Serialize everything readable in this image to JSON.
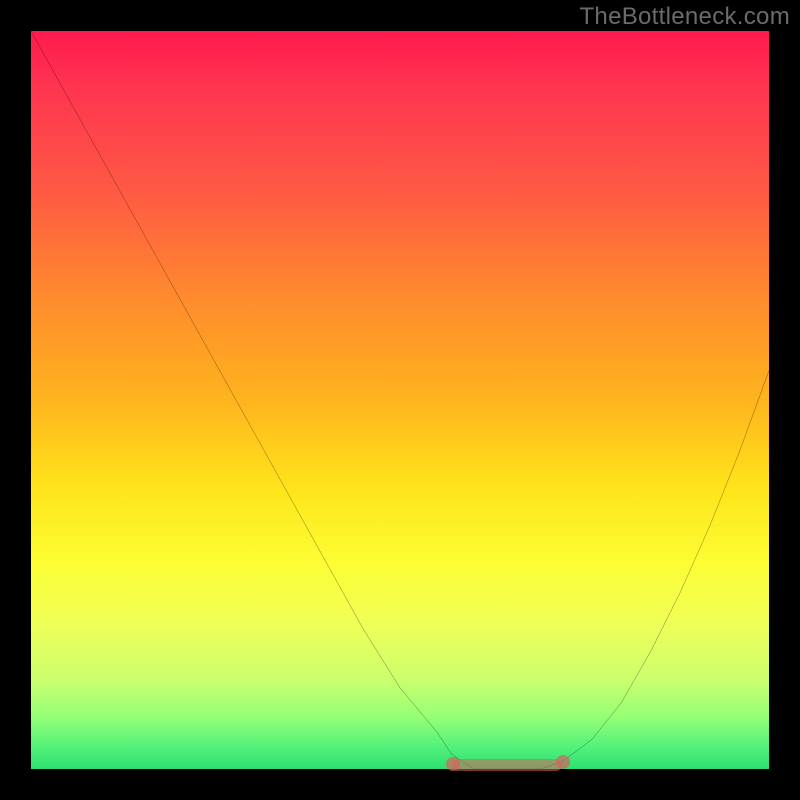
{
  "watermark": "TheBottleneck.com",
  "chart_data": {
    "type": "line",
    "title": "",
    "xlabel": "",
    "ylabel": "",
    "xlim": [
      0,
      100
    ],
    "ylim": [
      0,
      100
    ],
    "series": [
      {
        "name": "bottleneck-curve",
        "x": [
          0,
          5,
          10,
          15,
          20,
          25,
          30,
          35,
          40,
          45,
          50,
          55,
          57,
          60,
          63,
          66,
          69,
          72,
          76,
          80,
          84,
          88,
          92,
          96,
          100
        ],
        "y": [
          100,
          91,
          82,
          73,
          64,
          55,
          46,
          37,
          28,
          19,
          11,
          5,
          2,
          0,
          0,
          0,
          0,
          1,
          4,
          9,
          16,
          24,
          33,
          43,
          54
        ]
      }
    ],
    "trough": {
      "x_start": 57,
      "x_end": 72,
      "y": 0
    },
    "gradient_stops": [
      {
        "pos": 0.0,
        "color": "#ff1a4e"
      },
      {
        "pos": 0.22,
        "color": "#ff5a43"
      },
      {
        "pos": 0.5,
        "color": "#ffb41e"
      },
      {
        "pos": 0.72,
        "color": "#fdfd33"
      },
      {
        "pos": 0.93,
        "color": "#94ff76"
      },
      {
        "pos": 1.0,
        "color": "#2ee06e"
      }
    ],
    "background_gradient_direction": "vertical",
    "note": "V-shaped bottleneck curve on a red→green gradient square; y encodes bottleneck %, minimum (≈0) reached around x≈60–72."
  }
}
